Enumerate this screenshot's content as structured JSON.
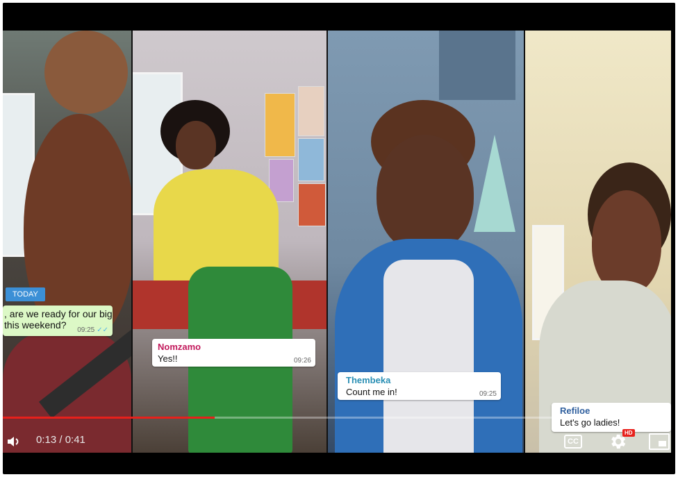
{
  "chat": {
    "date_badge": "TODAY",
    "messages": [
      {
        "text_line1": ", are we ready for our big",
        "text_line2": "this weekend?",
        "time": "09:25",
        "status": "read"
      },
      {
        "sender": "Nomzamo",
        "text": "Yes!!",
        "time": "09:26",
        "sender_color": "#c2185b"
      },
      {
        "sender": "Thembeka",
        "text": "Count me in!",
        "time": "09:25",
        "sender_color": "#2a8fb4"
      },
      {
        "sender": "Refiloe",
        "text": "Let's go ladies!",
        "time": "",
        "sender_color": "#2f5f9e"
      }
    ]
  },
  "player": {
    "current_time": "0:13",
    "duration": "0:41",
    "time_display": "0:13 / 0:41",
    "progress_fraction": 0.317,
    "progress_color": "#e8201b",
    "cc_label": "CC",
    "quality_badge": "HD",
    "icons": [
      "volume-icon",
      "cc-icon",
      "settings-gear-icon",
      "miniplayer-icon"
    ]
  }
}
